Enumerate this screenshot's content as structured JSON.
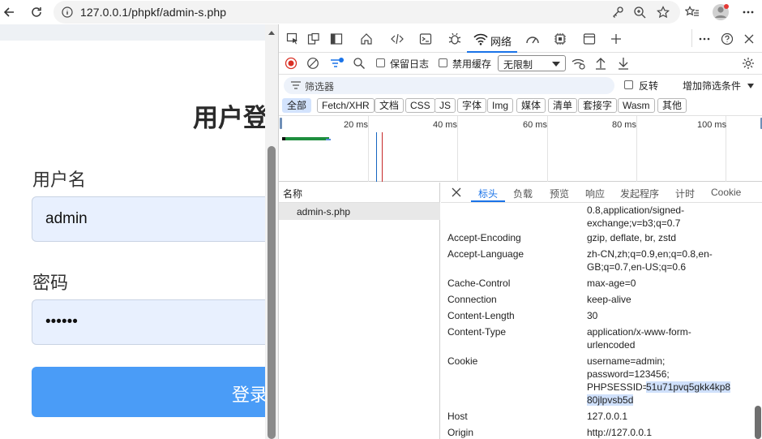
{
  "browser": {
    "url": "127.0.0.1/phpkf/admin-s.php"
  },
  "page": {
    "title": "用户登",
    "username_label": "用户名",
    "username_value": "admin",
    "password_label": "密码",
    "password_value": "••••••",
    "login_button": "登录"
  },
  "devtools": {
    "active_tab": "网络",
    "toolbar": {
      "preserve_log": "保留日志",
      "disable_cache": "禁用缓存",
      "throttle": "无限制"
    },
    "filter": {
      "placeholder": "筛选器",
      "invert": "反转",
      "more_filters": "增加筛选条件"
    },
    "types": [
      "全部",
      "Fetch/XHR",
      "文档",
      "CSS",
      "JS",
      "字体",
      "Img",
      "媒体",
      "清单",
      "套接字",
      "Wasm",
      "其他"
    ],
    "timeline_ticks": [
      "20 ms",
      "40 ms",
      "60 ms",
      "80 ms",
      "100 ms"
    ],
    "request_list": {
      "header": "名称",
      "rows": [
        "admin-s.php"
      ]
    },
    "detail_tabs": [
      "标头",
      "负载",
      "预览",
      "响应",
      "发起程序",
      "计时",
      "Cookie"
    ],
    "headers": [
      {
        "name": "",
        "value": "0.8,application/signed-\nexchange;v=b3;q=0.7"
      },
      {
        "name": "Accept-Encoding",
        "value": "gzip, deflate, br, zstd"
      },
      {
        "name": "Accept-Language",
        "value": "zh-CN,zh;q=0.9,en;q=0.8,en-\nGB;q=0.7,en-US;q=0.6"
      },
      {
        "name": "Cache-Control",
        "value": "max-age=0"
      },
      {
        "name": "Connection",
        "value": "keep-alive"
      },
      {
        "name": "Content-Length",
        "value": "30"
      },
      {
        "name": "Content-Type",
        "value": "application/x-www-form-\nurlencoded"
      },
      {
        "name": "Cookie",
        "value": "username=admin;\npassword=123456;\nPHPSESSID="
      },
      {
        "name": "Host",
        "value": "127.0.0.1"
      },
      {
        "name": "Origin",
        "value": "http://127.0.0.1"
      }
    ],
    "cookie_highlight_1": "51u71pvq5gkk4kp8",
    "cookie_highlight_2": "80jlpvsb5d"
  },
  "colors": {
    "accent": "#1a73e8",
    "login_button": "#4a9cf7",
    "input_bg": "#e8f0fe"
  }
}
